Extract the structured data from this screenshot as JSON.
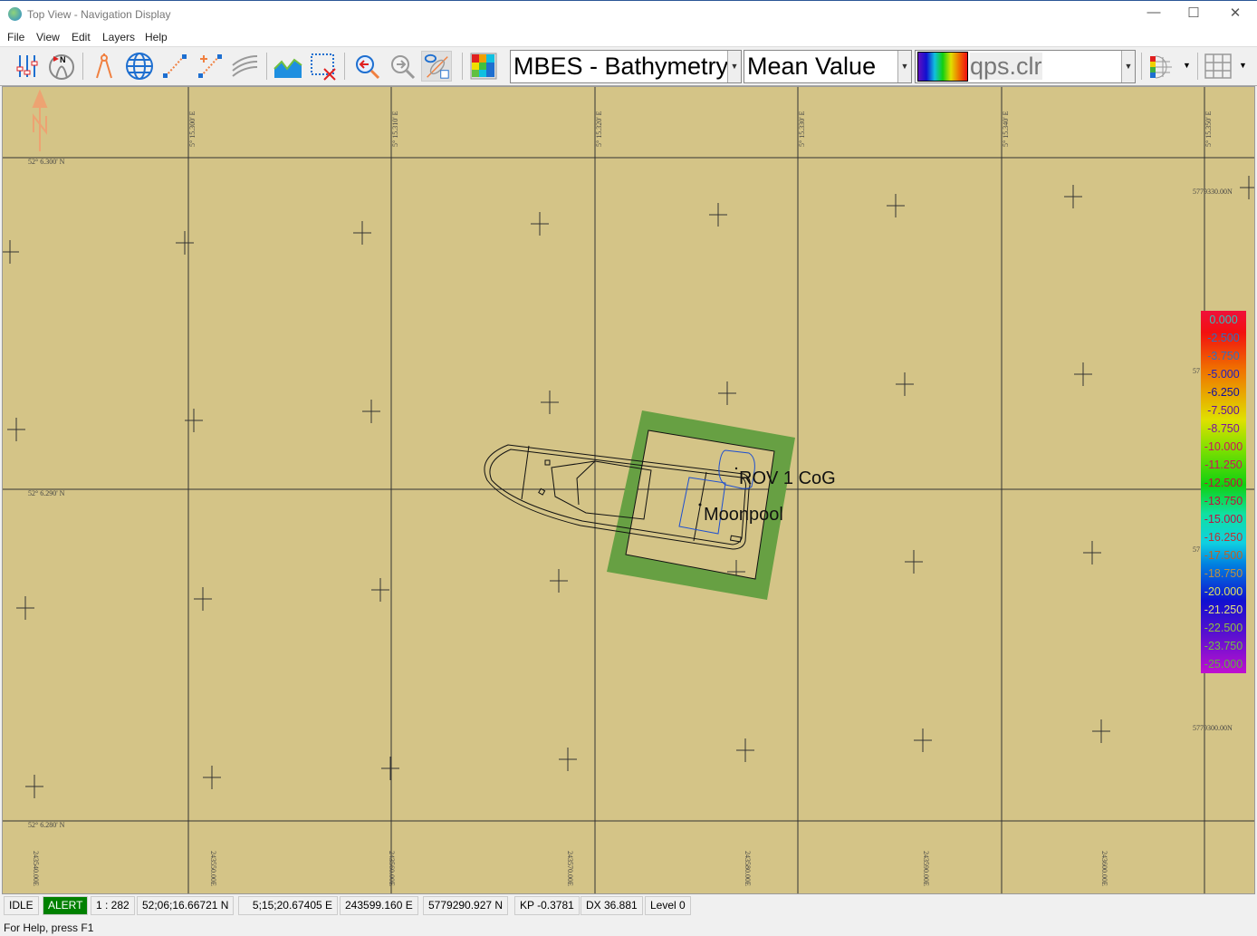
{
  "window": {
    "title": "Top View - Navigation Display",
    "minimize": "—",
    "maximize": "☐",
    "close": "✕"
  },
  "menu": [
    "File",
    "View",
    "Edit",
    "Layers",
    "Help"
  ],
  "toolbar": {
    "icons": [
      "settings-sliders-icon",
      "north-up-icon",
      "compass-divider-icon",
      "globe-icon",
      "line-tool-icon",
      "add-line-icon",
      "contours-icon",
      "profile-chart-icon",
      "clear-selection-icon",
      "zoom-previous-icon",
      "zoom-next-icon",
      "visibility-icon",
      "color-grid-icon",
      "layer-colors-icon",
      "grid-icon"
    ],
    "data_source": "MBES - Bathymetry",
    "value_mode": "Mean Value",
    "color_file": "qps.clr"
  },
  "map": {
    "north_label": "N",
    "top_lon_labels": [
      "5° 15.300' E",
      "5° 15.310' E",
      "5° 15.320' E",
      "5° 15.330' E",
      "5° 15.340' E",
      "5° 15.350' E"
    ],
    "lat_labels": [
      "52° 6.300' N",
      "52° 6.290' N",
      "52° 6.280' N"
    ],
    "northing_labels": [
      "5779330.00N",
      "57",
      "57",
      "5779300.00N"
    ],
    "easting_labels": [
      "243540.00E",
      "243550.00E",
      "243560.00E",
      "243570.00E",
      "243580.00E",
      "243590.00E",
      "243600.00E"
    ],
    "object_labels": {
      "rov": "ROV 1 CoG",
      "moonpool": "Moonpool"
    },
    "colors": {
      "background": "#d4c487",
      "footprint": "#67a043",
      "grid": "#333333"
    }
  },
  "color_scale": [
    {
      "v": "0.000",
      "c": "#30c0c0"
    },
    {
      "v": "-2.500",
      "c": "#3070c0"
    },
    {
      "v": "-3.750",
      "c": "#3070c0"
    },
    {
      "v": "-5.000",
      "c": "#2020c0"
    },
    {
      "v": "-6.250",
      "c": "#1010a0"
    },
    {
      "v": "-7.500",
      "c": "#6010a0"
    },
    {
      "v": "-8.750",
      "c": "#8010a0"
    },
    {
      "v": "-10.000",
      "c": "#d01060"
    },
    {
      "v": "-11.250",
      "c": "#d01060"
    },
    {
      "v": "-12.500",
      "c": "#c01040"
    },
    {
      "v": "-13.750",
      "c": "#c01040"
    },
    {
      "v": "-15.000",
      "c": "#c01040"
    },
    {
      "v": "-16.250",
      "c": "#c03030"
    },
    {
      "v": "-17.500",
      "c": "#c06020"
    },
    {
      "v": "-18.750",
      "c": "#c09040"
    },
    {
      "v": "-20.000",
      "c": "#e0e060"
    },
    {
      "v": "-21.250",
      "c": "#e0e080"
    },
    {
      "v": "-22.500",
      "c": "#90c040"
    },
    {
      "v": "-23.750",
      "c": "#70c040"
    },
    {
      "v": "-25.000",
      "c": "#60b040"
    }
  ],
  "status": {
    "state": "IDLE",
    "alert": "ALERT",
    "scale": "1 : 282",
    "lat": "52;06;16.66721 N",
    "lon": "5;15;20.67405 E",
    "easting": "243599.160 E",
    "northing": "5779290.927 N",
    "kp": "KP -0.3781",
    "dx": "DX 36.881",
    "level": "Level 0",
    "alert_color": "#008000"
  },
  "help": "For Help, press F1"
}
